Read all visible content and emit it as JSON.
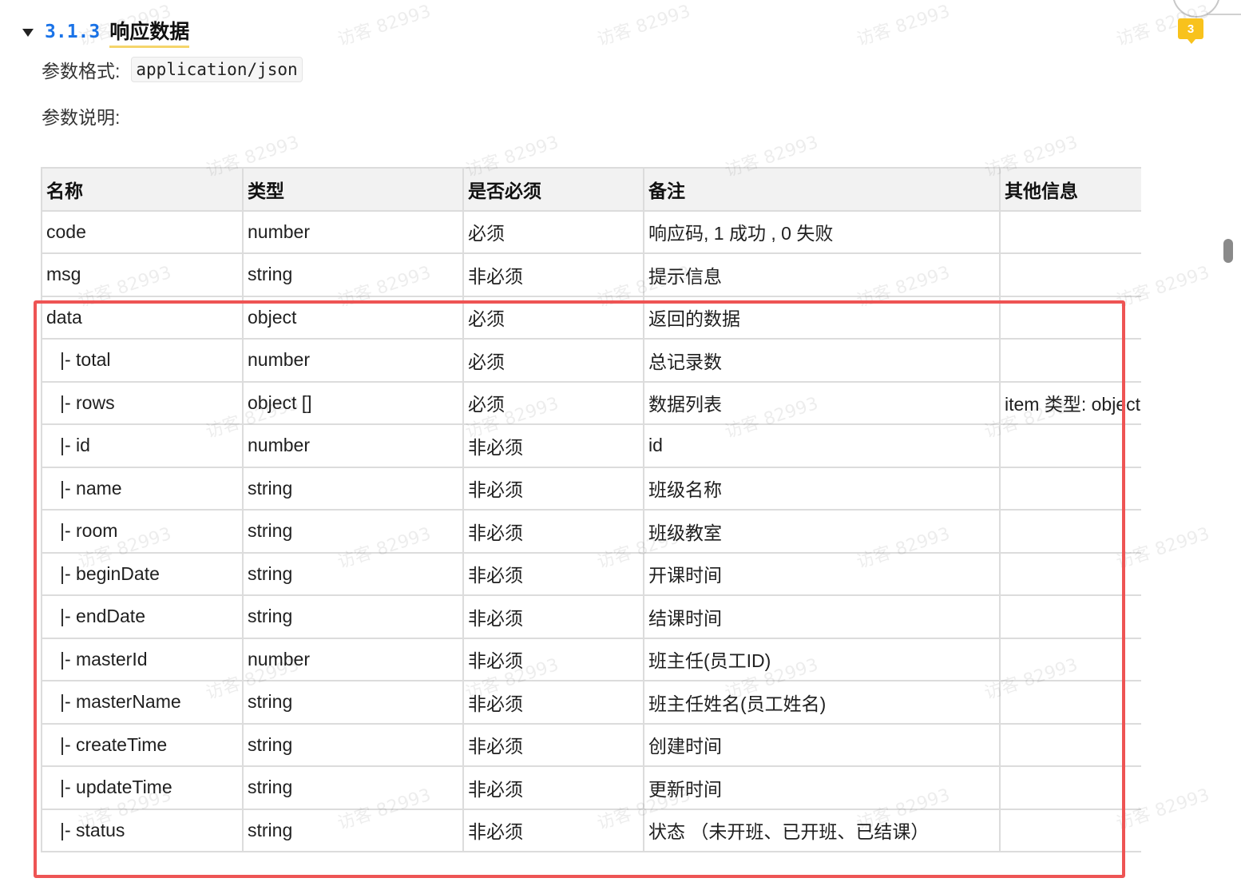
{
  "section": {
    "number": "3.1.3",
    "title": "响应数据"
  },
  "format": {
    "label": "参数格式:",
    "value": "application/json"
  },
  "description_label": "参数说明:",
  "comment_count": "3",
  "watermark_text": "访客 82993",
  "table": {
    "headers": [
      "名称",
      "类型",
      "是否必须",
      "备注",
      "其他信息"
    ],
    "rows": [
      {
        "name": "code",
        "type": "number",
        "required": "必须",
        "note": "响应码, 1 成功 , 0 失败",
        "other": ""
      },
      {
        "name": "msg",
        "type": "string",
        "required": "非必须",
        "note": "提示信息",
        "other": ""
      },
      {
        "name": "data",
        "type": "object",
        "required": "必须",
        "note": "返回的数据",
        "other": ""
      },
      {
        "name": "|- total",
        "type": "number",
        "required": "必须",
        "note": "总记录数",
        "other": ""
      },
      {
        "name": "|- rows",
        "type": "object []",
        "required": "必须",
        "note": "数据列表",
        "other": "item 类型: object"
      },
      {
        "name": "|- id",
        "type": "number",
        "required": "非必须",
        "note": "id",
        "other": ""
      },
      {
        "name": "|- name",
        "type": "string",
        "required": "非必须",
        "note": "班级名称",
        "other": ""
      },
      {
        "name": "|- room",
        "type": "string",
        "required": "非必须",
        "note": "班级教室",
        "other": ""
      },
      {
        "name": "|- beginDate",
        "type": "string",
        "required": "非必须",
        "note": "开课时间",
        "other": ""
      },
      {
        "name": "|- endDate",
        "type": "string",
        "required": "非必须",
        "note": "结课时间",
        "other": ""
      },
      {
        "name": "|- masterId",
        "type": "number",
        "required": "非必须",
        "note": "班主任(员工ID)",
        "other": ""
      },
      {
        "name": "|- masterName",
        "type": "string",
        "required": "非必须",
        "note": "班主任姓名(员工姓名)",
        "other": ""
      },
      {
        "name": "|- createTime",
        "type": "string",
        "required": "非必须",
        "note": "创建时间",
        "other": ""
      },
      {
        "name": "|- updateTime",
        "type": "string",
        "required": "非必须",
        "note": "更新时间",
        "other": ""
      },
      {
        "name": "|- status",
        "type": "string",
        "required": "非必须",
        "note": "状态 （未开班、已开班、已结课）",
        "other": ""
      }
    ]
  }
}
